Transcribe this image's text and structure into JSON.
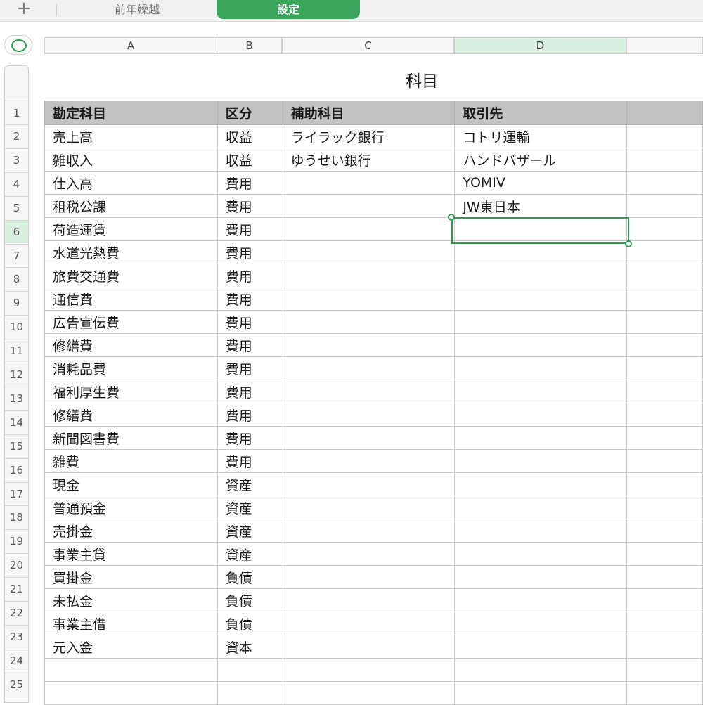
{
  "tabs": {
    "add_icon": "plus-icon",
    "items": [
      {
        "label": "前年繰越",
        "active": false
      },
      {
        "label": "設定",
        "active": true
      }
    ]
  },
  "sheet": {
    "title": "科目",
    "columns": [
      "A",
      "B",
      "C",
      "D"
    ],
    "selected_column": "D",
    "selected_row": "6",
    "selected_cell": "D6",
    "accent_color": "#3aa45b",
    "header": [
      "勘定科目",
      "区分",
      "補助科目",
      "取引先",
      ""
    ],
    "rows": [
      [
        "売上高",
        "収益",
        "ライラック銀行",
        "コトリ運輸",
        ""
      ],
      [
        "雑収入",
        "収益",
        "ゆうせい銀行",
        "ハンドバザール",
        ""
      ],
      [
        "仕入高",
        "費用",
        "",
        "YOMIV",
        ""
      ],
      [
        "租税公課",
        "費用",
        "",
        "JW東日本",
        ""
      ],
      [
        "荷造運賃",
        "費用",
        "",
        "",
        ""
      ],
      [
        "水道光熱費",
        "費用",
        "",
        "",
        ""
      ],
      [
        "旅費交通費",
        "費用",
        "",
        "",
        ""
      ],
      [
        "通信費",
        "費用",
        "",
        "",
        ""
      ],
      [
        "広告宣伝費",
        "費用",
        "",
        "",
        ""
      ],
      [
        "修繕費",
        "費用",
        "",
        "",
        ""
      ],
      [
        "消耗品費",
        "費用",
        "",
        "",
        ""
      ],
      [
        "福利厚生費",
        "費用",
        "",
        "",
        ""
      ],
      [
        "修繕費",
        "費用",
        "",
        "",
        ""
      ],
      [
        "新聞図書費",
        "費用",
        "",
        "",
        ""
      ],
      [
        "雑費",
        "費用",
        "",
        "",
        ""
      ],
      [
        "現金",
        "資産",
        "",
        "",
        ""
      ],
      [
        "普通預金",
        "資産",
        "",
        "",
        ""
      ],
      [
        "売掛金",
        "資産",
        "",
        "",
        ""
      ],
      [
        "事業主貸",
        "資産",
        "",
        "",
        ""
      ],
      [
        "買掛金",
        "負債",
        "",
        "",
        ""
      ],
      [
        "未払金",
        "負債",
        "",
        "",
        ""
      ],
      [
        "事業主借",
        "負債",
        "",
        "",
        ""
      ],
      [
        "元入金",
        "資本",
        "",
        "",
        ""
      ],
      [
        "",
        "",
        "",
        "",
        ""
      ],
      [
        "",
        "",
        "",
        "",
        ""
      ]
    ],
    "row_numbers": [
      "1",
      "2",
      "3",
      "4",
      "5",
      "6",
      "7",
      "8",
      "9",
      "10",
      "11",
      "12",
      "13",
      "14",
      "15",
      "16",
      "17",
      "18",
      "19",
      "20",
      "21",
      "22",
      "23",
      "24",
      "25"
    ]
  }
}
